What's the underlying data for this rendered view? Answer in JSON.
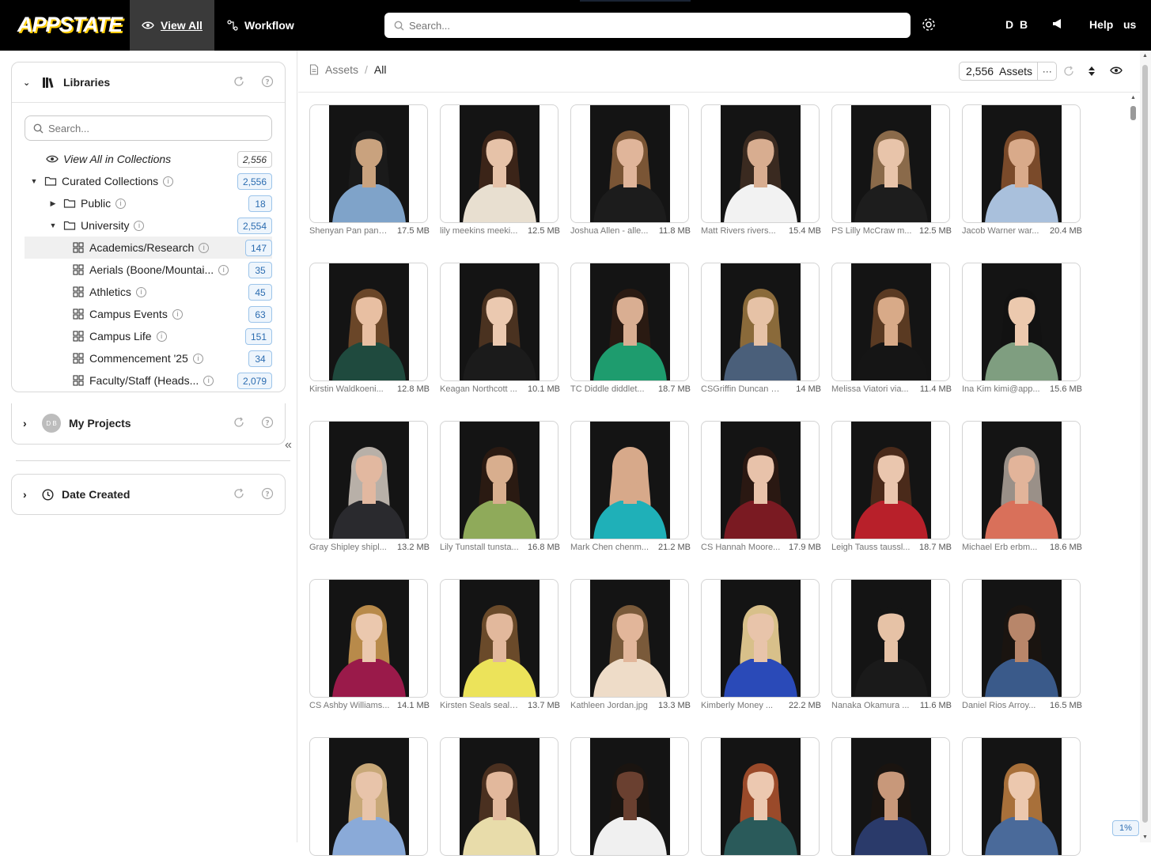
{
  "topbar": {
    "logo_app": "APP",
    "logo_state": "STATE",
    "view_all_label": "View All",
    "workflow_label": "Workflow",
    "search_placeholder": "Search...",
    "user_initials": "D B",
    "help_label": "Help",
    "lang_label": "us"
  },
  "sidebar": {
    "libraries_title": "Libraries",
    "search_placeholder": "Search...",
    "view_all_collections": {
      "label": "View All in Collections",
      "count": "2,556"
    },
    "tree": [
      {
        "label": "Curated Collections",
        "count": "2,556"
      },
      {
        "label": "Public",
        "count": "18"
      },
      {
        "label": "University",
        "count": "2,554"
      },
      {
        "label": "Academics/Research",
        "count": "147"
      },
      {
        "label": "Aerials (Boone/Mountai...",
        "count": "35"
      },
      {
        "label": "Athletics",
        "count": "45"
      },
      {
        "label": "Campus Events",
        "count": "63"
      },
      {
        "label": "Campus Life",
        "count": "151"
      },
      {
        "label": "Commencement '25",
        "count": "34"
      },
      {
        "label": "Faculty/Staff (Heads...",
        "count": "2,079"
      }
    ],
    "projects_title": "My Projects",
    "projects_avatar": "D B",
    "date_created_title": "Date Created"
  },
  "main": {
    "breadcrumb_root": "Assets",
    "breadcrumb_sep": "/",
    "breadcrumb_current": "All",
    "asset_count": "2,556  Assets",
    "more_label": "···",
    "zoom_pct": "1%",
    "assets": [
      {
        "name": "Shenyan Pan pans...",
        "size": "17.5 MB",
        "shirt": "#7fa3c9",
        "skin": "#c9a27e",
        "hair": "#1a1a1a"
      },
      {
        "name": "lily meekins meeki...",
        "size": "12.5 MB",
        "shirt": "#e8dfd0",
        "skin": "#e6c2a8",
        "hair": "#3b2418"
      },
      {
        "name": "Joshua Allen - alle...",
        "size": "11.8 MB",
        "shirt": "#1c1c1c",
        "skin": "#e0b59a",
        "hair": "#7a5535"
      },
      {
        "name": "Matt Rivers rivers...",
        "size": "15.4 MB",
        "shirt": "#f2f2f2",
        "skin": "#d8ad90",
        "hair": "#3a2a20"
      },
      {
        "name": "PS Lilly McCraw m...",
        "size": "12.5 MB",
        "shirt": "#1d1d1d",
        "skin": "#e8c4aa",
        "hair": "#8a6a4a"
      },
      {
        "name": "Jacob Warner war...",
        "size": "20.4 MB",
        "shirt": "#a9c0dc",
        "skin": "#d9aa8a",
        "hair": "#7a4a2a"
      },
      {
        "name": "Kirstin Waldkoeni...",
        "size": "12.8 MB",
        "shirt": "#1f4a3e",
        "skin": "#e8bfa2",
        "hair": "#6a4628"
      },
      {
        "name": "Keagan Northcott ...",
        "size": "10.1 MB",
        "shirt": "#1b1b1b",
        "skin": "#ebc9b0",
        "hair": "#4a3220"
      },
      {
        "name": "TC Diddle diddlet...",
        "size": "18.7 MB",
        "shirt": "#1e9c6e",
        "skin": "#d9ae92",
        "hair": "#2a1a12"
      },
      {
        "name": "CSGriffin Duncan d...",
        "size": "14 MB",
        "shirt": "#4a5f7a",
        "skin": "#e6c2a6",
        "hair": "#8a6a3a"
      },
      {
        "name": "Melissa Viatori via...",
        "size": "11.4 MB",
        "shirt": "#151515",
        "skin": "#d8aa88",
        "hair": "#5a3a22"
      },
      {
        "name": "Ina Kim kimi@app...",
        "size": "15.6 MB",
        "shirt": "#7f9e80",
        "skin": "#ecc9ae",
        "hair": "#121212"
      },
      {
        "name": "Gray Shipley shipl...",
        "size": "13.2 MB",
        "shirt": "#2a2a2e",
        "skin": "#e2b8a0",
        "hair": "#b8b0a8"
      },
      {
        "name": "Lily Tunstall tunsta...",
        "size": "16.8 MB",
        "shirt": "#8faa5a",
        "skin": "#d8ae8e",
        "hair": "#2a1a12"
      },
      {
        "name": "Mark Chen chenm...",
        "size": "21.2 MB",
        "shirt": "#1fb0b8",
        "skin": "#d7a98a",
        "hair": "#d7a98a"
      },
      {
        "name": "CS Hannah Moore...",
        "size": "17.9 MB",
        "shirt": "#7a1a22",
        "skin": "#e8c2aa",
        "hair": "#2a1812"
      },
      {
        "name": "Leigh Tauss taussl...",
        "size": "18.7 MB",
        "shirt": "#b8202a",
        "skin": "#eac6ae",
        "hair": "#4a2a1a"
      },
      {
        "name": "Michael Erb erbm...",
        "size": "18.6 MB",
        "shirt": "#d9705a",
        "skin": "#e2b49a",
        "hair": "#9a9088"
      },
      {
        "name": "CS Ashby Williams...",
        "size": "14.1 MB",
        "shirt": "#9a1a4a",
        "skin": "#ebc8ae",
        "hair": "#b88a4a"
      },
      {
        "name": "Kirsten Seals seals...",
        "size": "13.7 MB",
        "shirt": "#ece35a",
        "skin": "#e2b89c",
        "hair": "#6a4a2a"
      },
      {
        "name": "Kathleen Jordan.jpg",
        "size": "13.3 MB",
        "shirt": "#eedcc8",
        "skin": "#e2b69a",
        "hair": "#7a5a3a"
      },
      {
        "name": "Kimberly Money ...",
        "size": "22.2 MB",
        "shirt": "#2a4ab8",
        "skin": "#e8c4aa",
        "hair": "#d8c08a"
      },
      {
        "name": "Nanaka Okamura ...",
        "size": "11.6 MB",
        "shirt": "#1a1a1a",
        "skin": "#e6c2a6",
        "hair": "#141414"
      },
      {
        "name": "Daniel Rios Arroy...",
        "size": "16.5 MB",
        "shirt": "#3a5a8a",
        "skin": "#b8866a",
        "hair": "#1a1410"
      },
      {
        "name": "",
        "size": "",
        "shirt": "#8aaad8",
        "skin": "#e8c4aa",
        "hair": "#c8a878"
      },
      {
        "name": "",
        "size": "",
        "shirt": "#e8dcaa",
        "skin": "#e2b89c",
        "hair": "#4a3020"
      },
      {
        "name": "",
        "size": "",
        "shirt": "#f0f0f0",
        "skin": "#6a4030",
        "hair": "#1a1410"
      },
      {
        "name": "",
        "size": "",
        "shirt": "#2a5a5a",
        "skin": "#ecc8b0",
        "hair": "#9a4a2a"
      },
      {
        "name": "",
        "size": "",
        "shirt": "#2a3a6a",
        "skin": "#c8987a",
        "hair": "#1a1410"
      },
      {
        "name": "",
        "size": "",
        "shirt": "#4a6a9a",
        "skin": "#ecc8ae",
        "hair": "#a8703a"
      }
    ]
  },
  "colors": {
    "topbar_bg": "#000000",
    "accent_gold": "#ffcc00",
    "badge_blue": "#2b6cb0",
    "photo_bg": "#141414"
  }
}
